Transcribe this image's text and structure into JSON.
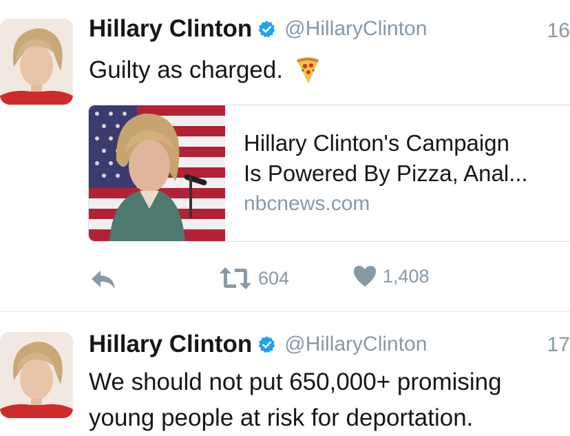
{
  "tweets": [
    {
      "author_name": "Hillary Clinton",
      "handle": "@HillaryClinton",
      "time": "16",
      "text": "Guilty as charged.",
      "emoji": "pizza-slice",
      "card": {
        "title_line1": "Hillary Clinton's Campaign",
        "title_line2": "Is Powered By Pizza, Anal...",
        "domain": "nbcnews.com"
      },
      "actions": {
        "retweets": "604",
        "likes": "1,408"
      }
    },
    {
      "author_name": "Hillary Clinton",
      "handle": "@HillaryClinton",
      "time": "17",
      "text": "We should not put 650,000+ promising young people at risk for deportation."
    }
  ],
  "colors": {
    "verified": "#1da1f2",
    "muted": "#8899a6",
    "text": "#14171a"
  },
  "icons": [
    "verified-badge-icon",
    "pizza-emoji-icon",
    "reply-icon",
    "retweet-icon",
    "heart-icon"
  ]
}
